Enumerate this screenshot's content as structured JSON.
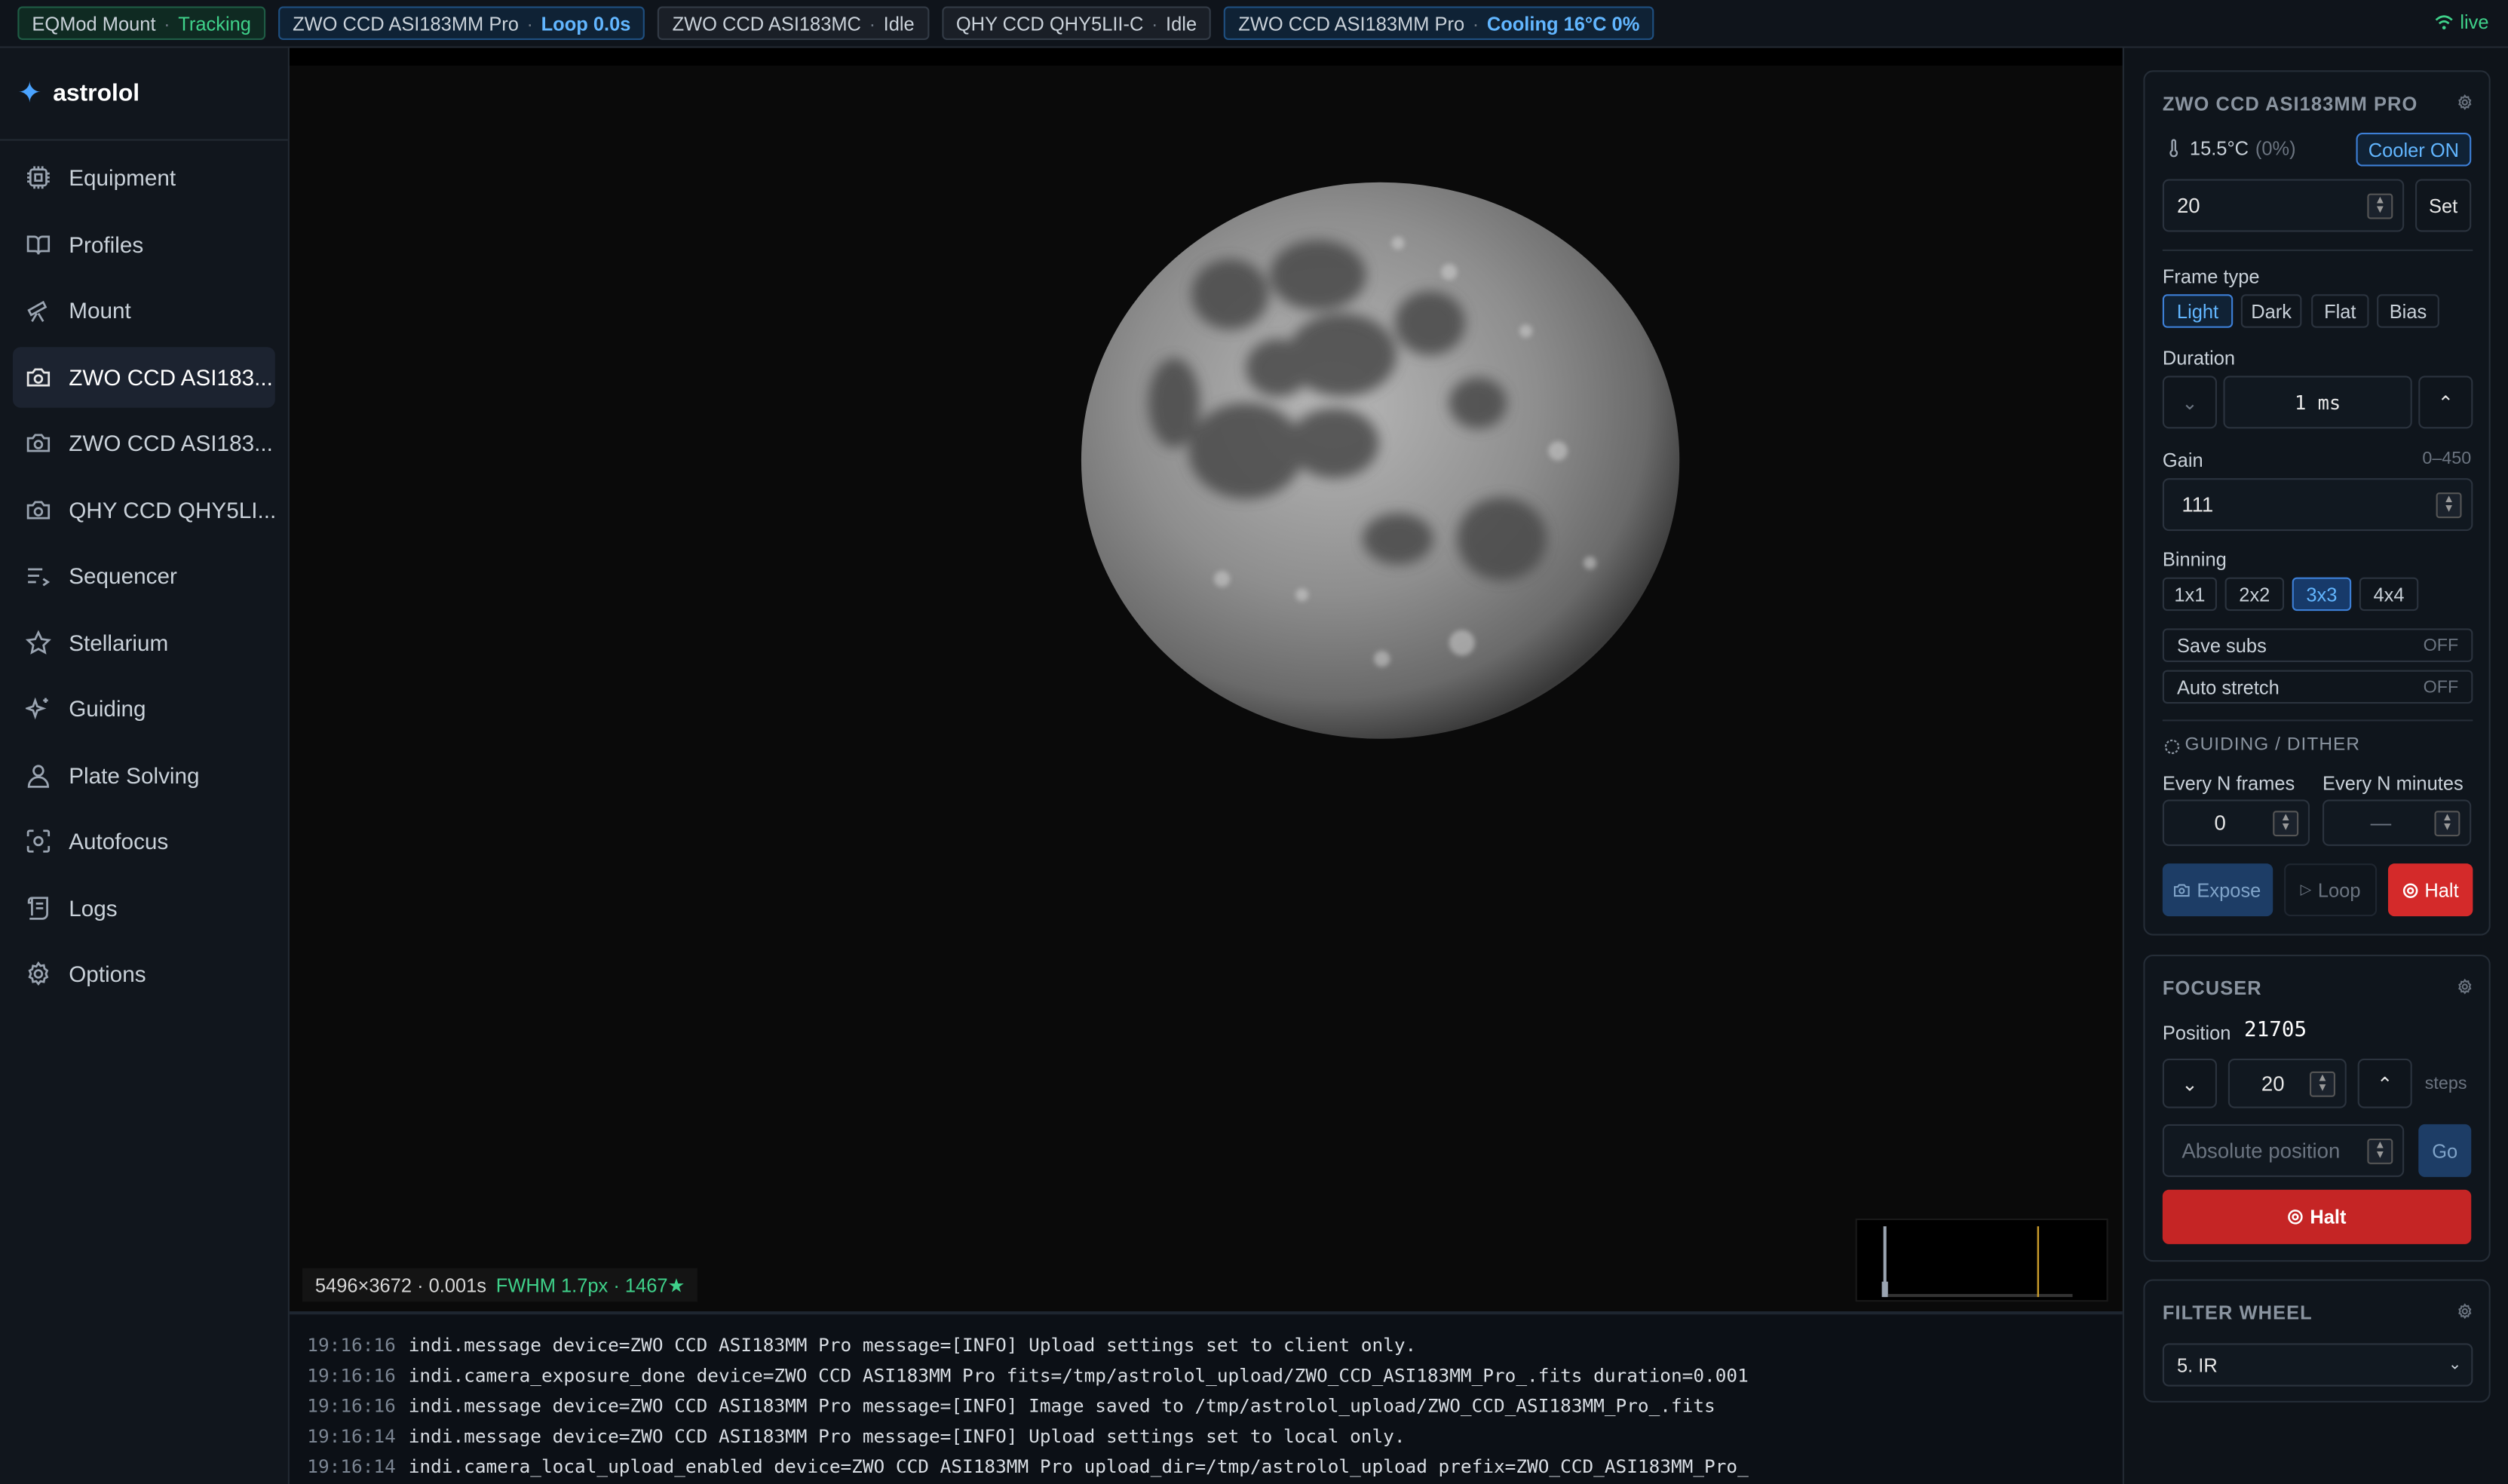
{
  "topbar": {
    "chips": [
      {
        "device": "EQMod Mount",
        "status": "Tracking",
        "style": "green"
      },
      {
        "device": "ZWO CCD ASI183MM Pro",
        "status": "Loop 0.0s",
        "style": "blue"
      },
      {
        "device": "ZWO CCD ASI183MC",
        "status": "Idle",
        "style": "gray"
      },
      {
        "device": "QHY CCD QHY5LII-C",
        "status": "Idle",
        "style": "gray"
      },
      {
        "device": "ZWO CCD ASI183MM Pro",
        "status": "Cooling 16°C 0%",
        "style": "blue"
      }
    ],
    "live_label": "live"
  },
  "sidebar": {
    "brand": "astrolol",
    "items": [
      {
        "label": "Equipment",
        "icon": "chip-icon"
      },
      {
        "label": "Profiles",
        "icon": "book-icon"
      },
      {
        "label": "Mount",
        "icon": "telescope-icon"
      },
      {
        "label": "ZWO CCD ASI183...",
        "icon": "camera-icon",
        "active": true
      },
      {
        "label": "ZWO CCD ASI183...",
        "icon": "camera-icon"
      },
      {
        "label": "QHY CCD QHY5LI...",
        "icon": "camera-icon"
      },
      {
        "label": "Sequencer",
        "icon": "list-icon"
      },
      {
        "label": "Stellarium",
        "icon": "star-icon"
      },
      {
        "label": "Guiding",
        "icon": "sparkle-icon"
      },
      {
        "label": "Plate Solving",
        "icon": "user-pin-icon"
      },
      {
        "label": "Autofocus",
        "icon": "focus-icon"
      },
      {
        "label": "Logs",
        "icon": "scroll-icon"
      },
      {
        "label": "Options",
        "icon": "gear-icon"
      }
    ]
  },
  "viewer": {
    "image_info": "5496×3672 · 0.001s",
    "fwhm": "FWHM 1.7px · 1467★"
  },
  "log": {
    "lines": [
      {
        "ts": "19:16:16",
        "msg": "indi.message device=ZWO CCD ASI183MM Pro message=[INFO] Upload settings set to client only."
      },
      {
        "ts": "19:16:16",
        "msg": "indi.camera_exposure_done device=ZWO CCD ASI183MM Pro fits=/tmp/astrolol_upload/ZWO_CCD_ASI183MM_Pro_.fits duration=0.001"
      },
      {
        "ts": "19:16:16",
        "msg": "indi.message device=ZWO CCD ASI183MM Pro message=[INFO] Image saved to /tmp/astrolol_upload/ZWO_CCD_ASI183MM_Pro_.fits"
      },
      {
        "ts": "19:16:14",
        "msg": "indi.message device=ZWO CCD ASI183MM Pro message=[INFO] Upload settings set to local only."
      },
      {
        "ts": "19:16:14",
        "msg": "indi.camera_local_upload_enabled device=ZWO CCD ASI183MM Pro upload_dir=/tmp/astrolol_upload prefix=ZWO_CCD_ASI183MM_Pro_"
      }
    ]
  },
  "camera": {
    "title": "ZWO CCD ASI183MM PRO",
    "temp": "15.5°C",
    "temp_pct": "(0%)",
    "cooler_btn": "Cooler ON",
    "setpoint": "20",
    "set_btn": "Set",
    "frame_type_label": "Frame type",
    "frame_types": [
      "Light",
      "Dark",
      "Flat",
      "Bias"
    ],
    "frame_type_selected": "Light",
    "duration_label": "Duration",
    "duration": "1 ms",
    "gain_label": "Gain",
    "gain_range": "0–450",
    "gain": "111",
    "binning_label": "Binning",
    "binning": [
      "1x1",
      "2x2",
      "3x3",
      "4x4"
    ],
    "binning_selected": "3x3",
    "save_subs": "Save subs",
    "save_subs_state": "OFF",
    "auto_stretch": "Auto stretch",
    "auto_stretch_state": "OFF",
    "guiding_title": "GUIDING / DITHER",
    "every_frames_label": "Every N frames",
    "every_frames": "0",
    "every_minutes_label": "Every N minutes",
    "every_minutes": "—",
    "expose_btn": "Expose",
    "loop_btn": "Loop",
    "halt_btn": "Halt"
  },
  "focuser": {
    "title": "FOCUSER",
    "position_label": "Position",
    "position": "21705",
    "step": "20",
    "steps_label": "steps",
    "abs_placeholder": "Absolute position",
    "go_btn": "Go",
    "halt_btn": "Halt"
  },
  "filter_wheel": {
    "title": "FILTER WHEEL",
    "selected": "5. IR"
  },
  "colors": {
    "accent": "#4aa3ff",
    "ok": "#3fd18a",
    "danger": "#d42a2a"
  }
}
